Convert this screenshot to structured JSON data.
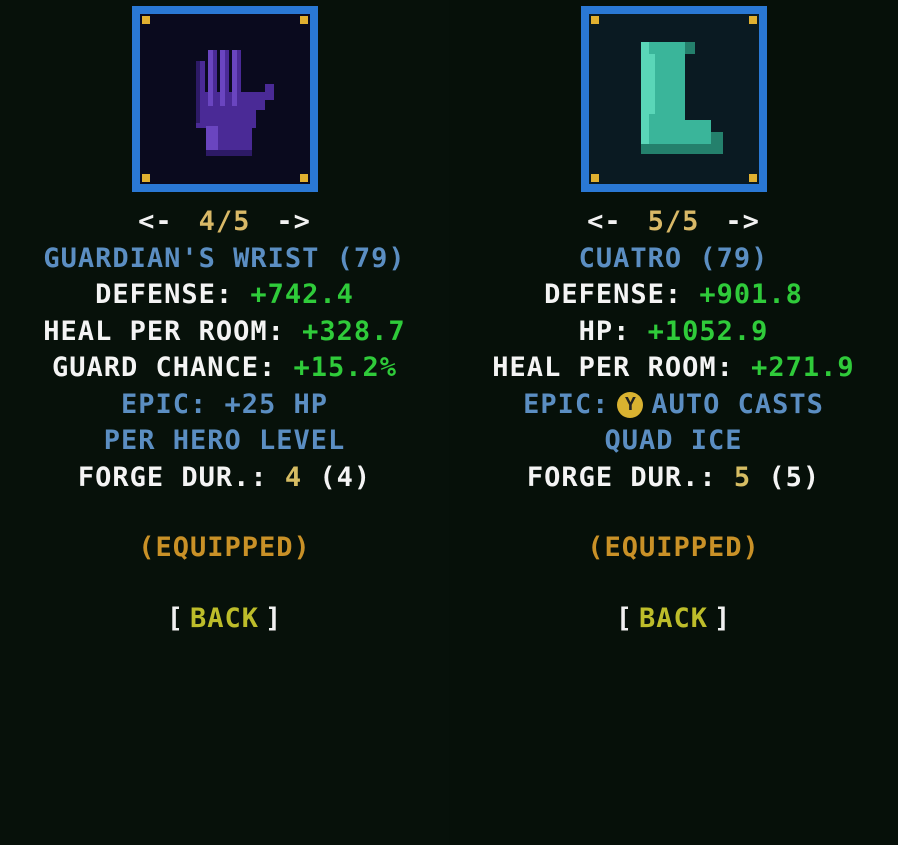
{
  "left": {
    "icon": "glove-icon",
    "nav": {
      "prev": "<-",
      "page": "4/5",
      "next": "->"
    },
    "title": "GUARDIAN'S WRIST (79)",
    "stats": [
      {
        "label": "DEFENSE: ",
        "value": "+742.4"
      },
      {
        "label": "HEAL PER ROOM: ",
        "value": "+328.7"
      },
      {
        "label": "GUARD CHANCE: ",
        "value": "+15.2%"
      }
    ],
    "epic_line1": "EPIC: +25 HP",
    "epic_line2": "PER HERO LEVEL",
    "forge_label": "FORGE DUR.: ",
    "forge_current": "4",
    "forge_max": " (4)",
    "equipped": "(EQUIPPED)",
    "back": {
      "open": "[",
      "label": "BACK",
      "close": "]"
    }
  },
  "right": {
    "icon": "boot-icon",
    "nav": {
      "prev": "<-",
      "page": "5/5",
      "next": "->"
    },
    "title": "CUATRO (79)",
    "stats": [
      {
        "label": "DEFENSE: ",
        "value": "+901.8"
      },
      {
        "label": "HP: ",
        "value": "+1052.9"
      },
      {
        "label": "HEAL PER ROOM: ",
        "value": "+271.9"
      }
    ],
    "epic_prefix": "EPIC:",
    "epic_button": "Y",
    "epic_suffix": "AUTO CASTS",
    "epic_line2": "QUAD ICE",
    "forge_label": "FORGE DUR.: ",
    "forge_current": "5",
    "forge_max": " (5)",
    "equipped": "(EQUIPPED)",
    "back": {
      "open": "[",
      "label": "BACK",
      "close": "]"
    }
  },
  "colors": {
    "frame": "#2a78d4",
    "title": "#5b8ec2",
    "stat_value": "#2fcb3a",
    "equipped": "#c99127",
    "back_button": "#bdbd2a"
  }
}
